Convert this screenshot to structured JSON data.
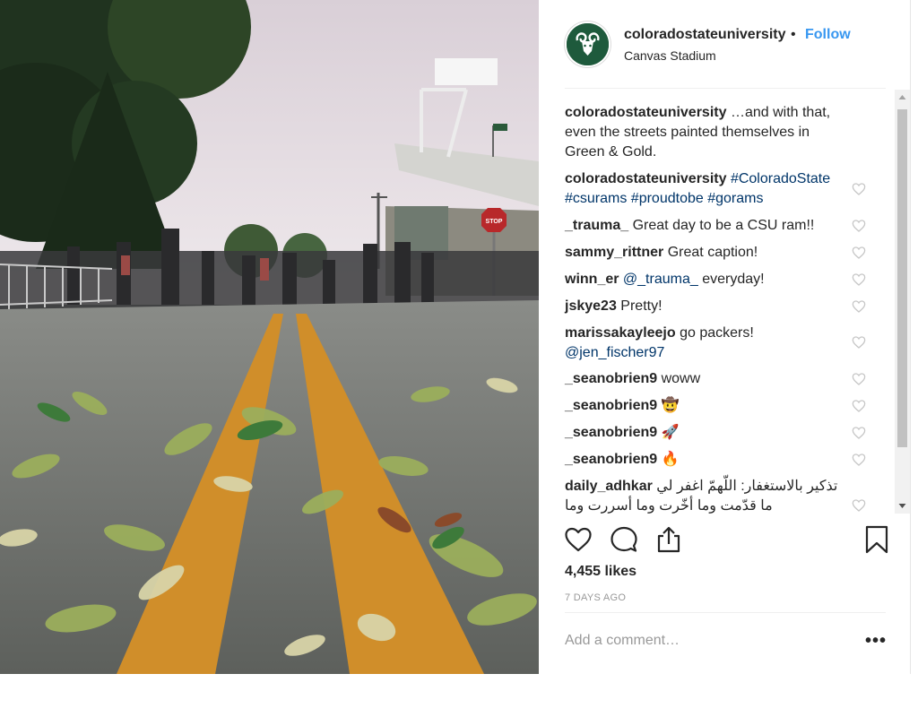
{
  "post": {
    "username": "coloradostateuniversity",
    "separator": "•",
    "follow_label": "Follow",
    "location": "Canvas Stadium",
    "avatar_icon": "ram-logo-icon",
    "brand_color": "#1e5a3c",
    "link_color": "#003569",
    "follow_color": "#3897f0",
    "photo_sign_text": "STOP"
  },
  "comments": [
    {
      "user": "coloradostateuniversity",
      "text": " …and with that, even the streets painted themselves in Green & Gold.",
      "links": ""
    },
    {
      "user": "coloradostateuniversity",
      "text": "",
      "links": " #ColoradoState #csurams #proudtobe #gorams"
    },
    {
      "user": "_trauma_",
      "text": " Great day to be a CSU ram!!",
      "links": ""
    },
    {
      "user": "sammy_rittner",
      "text": " Great caption!",
      "links": ""
    },
    {
      "user": "winn_er",
      "text": " everyday!",
      "links": " @_trauma_"
    },
    {
      "user": "jskye23",
      "text": " Pretty!",
      "links": ""
    },
    {
      "user": "marissakayleejo",
      "text": " go packers!",
      "links": "@jen_fischer97"
    },
    {
      "user": "_seanobrien9",
      "text": " woww",
      "links": ""
    },
    {
      "user": "_seanobrien9",
      "text": " 🤠",
      "links": ""
    },
    {
      "user": "_seanobrien9",
      "text": " 🚀",
      "links": ""
    },
    {
      "user": "_seanobrien9",
      "text": " 🔥",
      "links": ""
    },
    {
      "user": "daily_adhkar",
      "text": " تذكير بالاستغفار: اللّهمّ اغفر لي ما قدّمت وما أخّرت وما أسررت وما",
      "links": ""
    }
  ],
  "actions": {
    "like_icon": "heart-icon",
    "comment_icon": "comment-bubble-icon",
    "share_icon": "share-icon",
    "save_icon": "bookmark-icon"
  },
  "likes_text": "4,455 likes",
  "timestamp": "7 DAYS AGO",
  "add_comment_placeholder": "Add a comment…",
  "more_label": "•••"
}
